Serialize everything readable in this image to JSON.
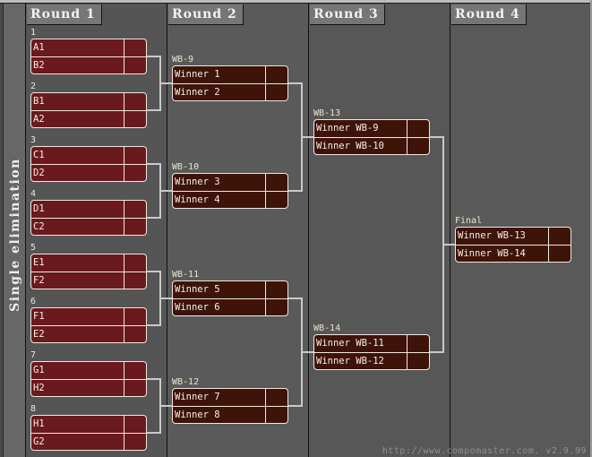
{
  "sidebar": {
    "title": "Single elimination"
  },
  "rounds": [
    {
      "label": "Round 1"
    },
    {
      "label": "Round 2"
    },
    {
      "label": "Round 3"
    },
    {
      "label": "Round 4"
    }
  ],
  "matches": {
    "r1": [
      {
        "label": "1",
        "p1": "A1",
        "p2": "B2",
        "s1": "",
        "s2": ""
      },
      {
        "label": "2",
        "p1": "B1",
        "p2": "A2",
        "s1": "",
        "s2": ""
      },
      {
        "label": "3",
        "p1": "C1",
        "p2": "D2",
        "s1": "",
        "s2": ""
      },
      {
        "label": "4",
        "p1": "D1",
        "p2": "C2",
        "s1": "",
        "s2": ""
      },
      {
        "label": "5",
        "p1": "E1",
        "p2": "F2",
        "s1": "",
        "s2": ""
      },
      {
        "label": "6",
        "p1": "F1",
        "p2": "E2",
        "s1": "",
        "s2": ""
      },
      {
        "label": "7",
        "p1": "G1",
        "p2": "H2",
        "s1": "",
        "s2": ""
      },
      {
        "label": "8",
        "p1": "H1",
        "p2": "G2",
        "s1": "",
        "s2": ""
      }
    ],
    "r2": [
      {
        "label": "WB-9",
        "p1": "Winner 1",
        "p2": "Winner 2",
        "s1": "",
        "s2": ""
      },
      {
        "label": "WB-10",
        "p1": "Winner 3",
        "p2": "Winner 4",
        "s1": "",
        "s2": ""
      },
      {
        "label": "WB-11",
        "p1": "Winner 5",
        "p2": "Winner 6",
        "s1": "",
        "s2": ""
      },
      {
        "label": "WB-12",
        "p1": "Winner 7",
        "p2": "Winner 8",
        "s1": "",
        "s2": ""
      }
    ],
    "r3": [
      {
        "label": "WB-13",
        "p1": "Winner WB-9",
        "p2": "Winner WB-10",
        "s1": "",
        "s2": ""
      },
      {
        "label": "WB-14",
        "p1": "Winner WB-11",
        "p2": "Winner WB-12",
        "s1": "",
        "s2": ""
      }
    ],
    "r4": [
      {
        "label": "Final",
        "p1": "Winner WB-13",
        "p2": "Winner WB-14",
        "s1": "",
        "s2": ""
      }
    ]
  },
  "footer": {
    "watermark": "http://www.compomaster.com. v2.9.99"
  }
}
